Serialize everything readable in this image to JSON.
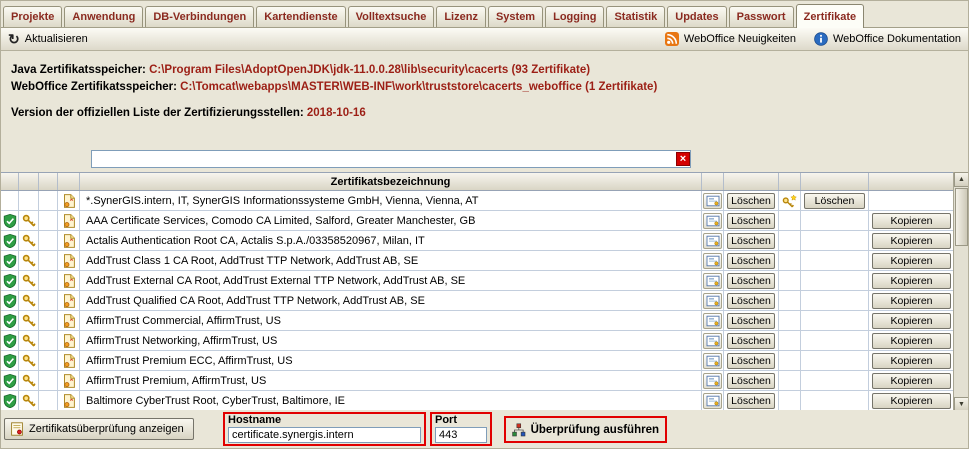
{
  "colors": {
    "highlight_red": "#e10000",
    "shield_green": "#2e9e44",
    "rss_orange": "#e87612",
    "path_maroon": "#9c1f15"
  },
  "tabs": [
    {
      "label": "Projekte",
      "active": false
    },
    {
      "label": "Anwendung",
      "active": false
    },
    {
      "label": "DB-Verbindungen",
      "active": false
    },
    {
      "label": "Kartendienste",
      "active": false
    },
    {
      "label": "Volltextsuche",
      "active": false
    },
    {
      "label": "Lizenz",
      "active": false
    },
    {
      "label": "System",
      "active": false
    },
    {
      "label": "Logging",
      "active": false
    },
    {
      "label": "Statistik",
      "active": false
    },
    {
      "label": "Updates",
      "active": false
    },
    {
      "label": "Passwort",
      "active": false
    },
    {
      "label": "Zertifikate",
      "active": true
    }
  ],
  "toolbar": {
    "refresh_glyph": "↻",
    "refresh_label": "Aktualisieren",
    "news_label": "WebOffice Neuigkeiten",
    "docs_label": "WebOffice Dokumentation"
  },
  "info": {
    "java_label": "Java Zertifikatsspeicher:",
    "java_value": "C:\\Program Files\\AdoptOpenJDK\\jdk-11.0.0.28\\lib\\security\\cacerts (93 Zertifikate)",
    "weboffice_label": "WebOffice Zertifikatsspeicher:",
    "weboffice_value": "C:\\Tomcat\\webapps\\MASTER\\WEB-INF\\work\\truststore\\cacerts_weboffice (1 Zertifikate)",
    "version_label": "Version der offiziellen Liste der Zertifizierungsstellen:",
    "version_value": "2018-10-16"
  },
  "search": {
    "value": "",
    "clear_glyph": "×"
  },
  "table": {
    "header": "Zertifikatsbezeichnung",
    "labels": {
      "delete": "Löschen",
      "copy": "Kopieren"
    },
    "rows": [
      {
        "name": "*.SynerGIS.intern, IT, SynerGIS Informationssysteme GmbH, Vienna, Vienna, AT"
      },
      {
        "name": "AAA Certificate Services, Comodo CA Limited, Salford, Greater Manchester, GB"
      },
      {
        "name": "Actalis Authentication Root CA, Actalis S.p.A./03358520967, Milan, IT"
      },
      {
        "name": "AddTrust Class 1 CA Root, AddTrust TTP Network, AddTrust AB, SE"
      },
      {
        "name": "AddTrust External CA Root, AddTrust External TTP Network, AddTrust AB, SE"
      },
      {
        "name": "AddTrust Qualified CA Root, AddTrust TTP Network, AddTrust AB, SE"
      },
      {
        "name": "AffirmTrust Commercial, AffirmTrust, US"
      },
      {
        "name": "AffirmTrust Networking, AffirmTrust, US"
      },
      {
        "name": "AffirmTrust Premium ECC, AffirmTrust, US"
      },
      {
        "name": "AffirmTrust Premium, AffirmTrust, US"
      },
      {
        "name": "Baltimore CyberTrust Root, CyberTrust, Baltimore, IE"
      }
    ]
  },
  "scrollbar": {
    "up_glyph": "▲",
    "down_glyph": "▼"
  },
  "footer": {
    "show_button": "Zertifikatsüberprüfung anzeigen",
    "hostname_label": "Hostname",
    "hostname_value": "certificate.synergis.intern",
    "port_label": "Port",
    "port_value": "443",
    "run_button": "Überprüfung ausführen"
  }
}
